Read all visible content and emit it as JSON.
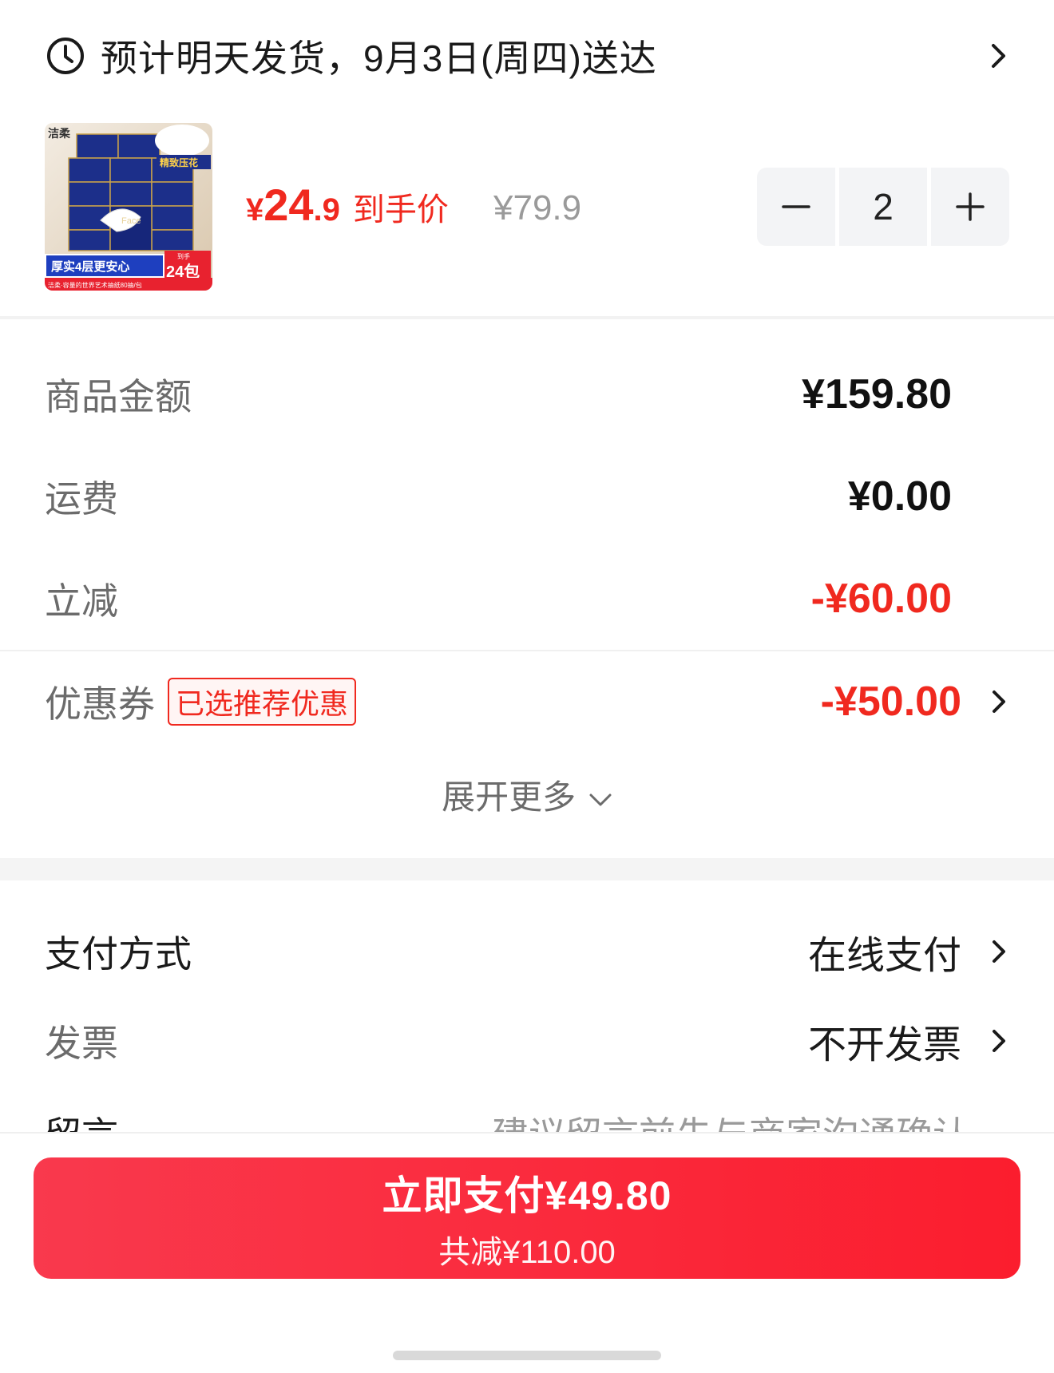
{
  "delivery": {
    "text": "预计明天发货，9月3日(周四)送达"
  },
  "product": {
    "price_yen": "¥",
    "price_int": "24",
    "price_dec": ".9",
    "price_tag": "到手价",
    "original_price": "¥79.9",
    "quantity": "2",
    "thumb_text": {
      "brand": "洁柔",
      "corner_label": "精致压花",
      "banner": "厚实4层更安心",
      "count_small": "到手",
      "count": "24包",
      "footnote": "洁柔·容量的世界艺术抽纸80抽/包",
      "box_label": "Face"
    }
  },
  "amounts": {
    "goods_label": "商品金额",
    "goods_value": "¥159.80",
    "shipping_label": "运费",
    "shipping_value": "¥0.00",
    "discount_label": "立减",
    "discount_value": "-¥60.00",
    "coupon_label": "优惠券",
    "coupon_badge": "已选推荐优惠",
    "coupon_value": "-¥50.00",
    "expand_label": "展开更多"
  },
  "payment": {
    "method_label": "支付方式",
    "method_value": "在线支付",
    "invoice_label": "发票",
    "invoice_value": "不开发票",
    "message_label": "留言",
    "message_hint": "建议留言前先与商家沟通确认"
  },
  "bottom": {
    "pay_label": "立即支付¥49.80",
    "saved_label": "共减¥110.00"
  },
  "colors": {
    "accent_red": "#f0291f",
    "button_red": "#fb1d2e",
    "stepper_bg": "#f3f4f6"
  }
}
